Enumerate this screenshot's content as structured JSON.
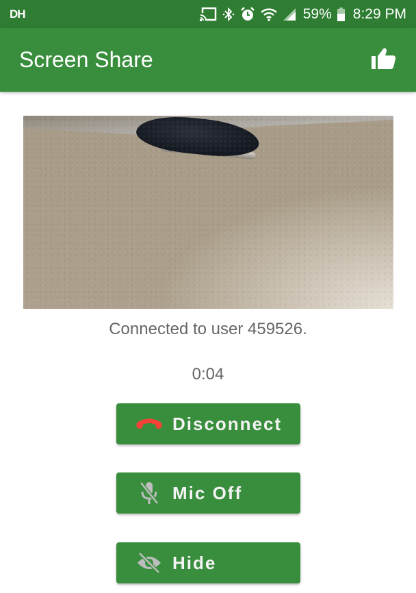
{
  "status_bar": {
    "carrier_badge": "DH",
    "icons": [
      "cast-icon",
      "bluetooth-icon",
      "alarm-icon",
      "wifi-icon",
      "cell-signal-icon",
      "battery-icon"
    ],
    "battery_percent": "59%",
    "time": "8:29 PM"
  },
  "app_bar": {
    "title": "Screen Share",
    "action_icon": "thumbs-up-icon"
  },
  "video": {
    "description": "camera preview"
  },
  "connection": {
    "status": "Connected to user 459526.",
    "elapsed": "0:04"
  },
  "buttons": [
    {
      "label": "Disconnect",
      "icon": "phone-hangup-icon",
      "icon_color": "#f44336"
    },
    {
      "label": "Mic Off",
      "icon": "mic-off-icon",
      "icon_color": "#bdbdbd"
    },
    {
      "label": "Hide",
      "icon": "eye-off-icon",
      "icon_color": "#bdbdbd"
    }
  ],
  "colors": {
    "status_bar": "#2e7d32",
    "primary": "#388e3c",
    "text_secondary": "#666666"
  }
}
